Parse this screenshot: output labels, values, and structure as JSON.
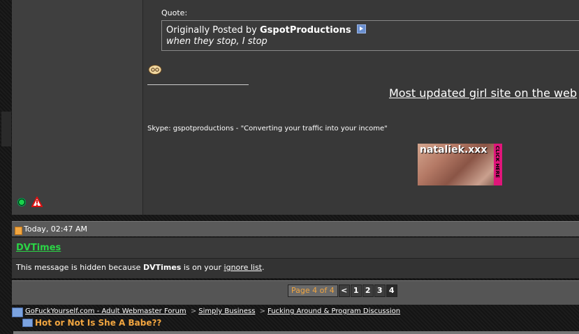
{
  "post": {
    "quote_label": "Quote:",
    "quote_prefix": "Originally Posted by",
    "quote_author": "GspotProductions",
    "quote_text": "when they stop, I stop",
    "signature_link": "Most updated girl site on the web",
    "signature_text": "Skype: gspotproductions - \"Converting your traffic into your income\"",
    "banner_text": "nataliek.xxx",
    "banner_side_text": "CLICK HERE"
  },
  "post2": {
    "date": "Today, 02:47 AM",
    "username": "DVTimes",
    "hidden_prefix": "This message is hidden because ",
    "hidden_user": "DVTimes",
    "hidden_mid": " is on your ",
    "ignore_link": "ignore list",
    "hidden_suffix": "."
  },
  "pagination": {
    "label": "Page 4 of 4",
    "prev": "<",
    "pages": [
      "1",
      "2",
      "3",
      "4"
    ],
    "current": "4"
  },
  "breadcrumb": {
    "items": [
      "GoFuckYourself.com - Adult Webmaster Forum",
      "Simply Business",
      "Fucking Around & Program Discussion"
    ],
    "separator": ">",
    "thread_title": "Hot or Not Is She A Babe??"
  },
  "colors": {
    "username_green": "#2bd446",
    "accent_orange": "#f2a640",
    "online_green": "#19d24c"
  }
}
